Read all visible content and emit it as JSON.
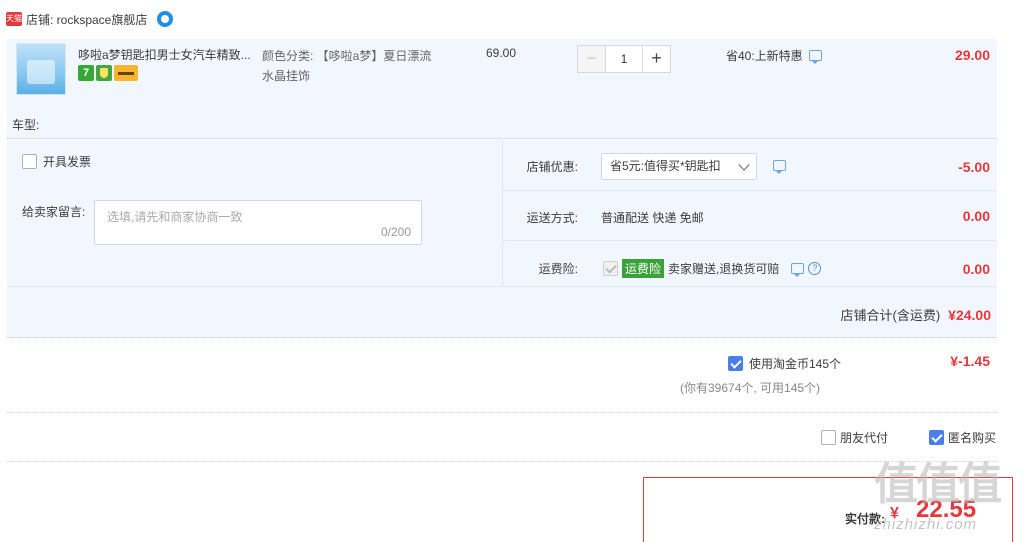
{
  "shop": {
    "badge": "天猫",
    "label": "店铺: rockspace旗舰店"
  },
  "item": {
    "title": "哆啦a梦钥匙扣男士女汽车精致...",
    "sku_line1": "颜色分类: 【哆啦a梦】夏日漂流",
    "sku_line2": "水晶挂饰",
    "price": "69.00",
    "quantity": "1",
    "qty_minus": "−",
    "qty_plus": "+",
    "promo": "省40:上新特惠",
    "subtotal": "29.00",
    "service_seven": "7",
    "car_type_label": "车型:"
  },
  "options": {
    "invoice_label": "开具发票",
    "note_label": "给卖家留言:",
    "note_placeholder": "选填,请先和商家协商一致",
    "note_count": "0/200",
    "coupon_label": "店铺优惠:",
    "coupon_value": "省5元:值得买*钥匙扣",
    "coupon_amount": "-5.00",
    "shipping_label": "运送方式:",
    "shipping_value": "普通配送 快递 免邮",
    "shipping_amount": "0.00",
    "insurance_label": "运费险:",
    "insurance_badge": "运费险",
    "insurance_text": "卖家赠送,退换货可赔",
    "insurance_amount": "0.00",
    "store_total_label": "店铺合计(含运费)",
    "store_total_value": "¥24.00"
  },
  "coins": {
    "label": "使用淘金币145个",
    "amount": "¥-1.45",
    "sub": "(你有39674个, 可用145个)"
  },
  "extras": {
    "friend_pay": "朋友代付",
    "anonymous": "匿名购买"
  },
  "payment": {
    "label": "实付款:",
    "currency": "¥",
    "amount": "22.55"
  },
  "watermark": {
    "text": "值值值",
    "sub": "zhizhizhi.com"
  },
  "colors": {
    "price_red": "#e4393c",
    "panel_bg": "#f2f7ff",
    "check_blue": "#4a7ee8"
  }
}
